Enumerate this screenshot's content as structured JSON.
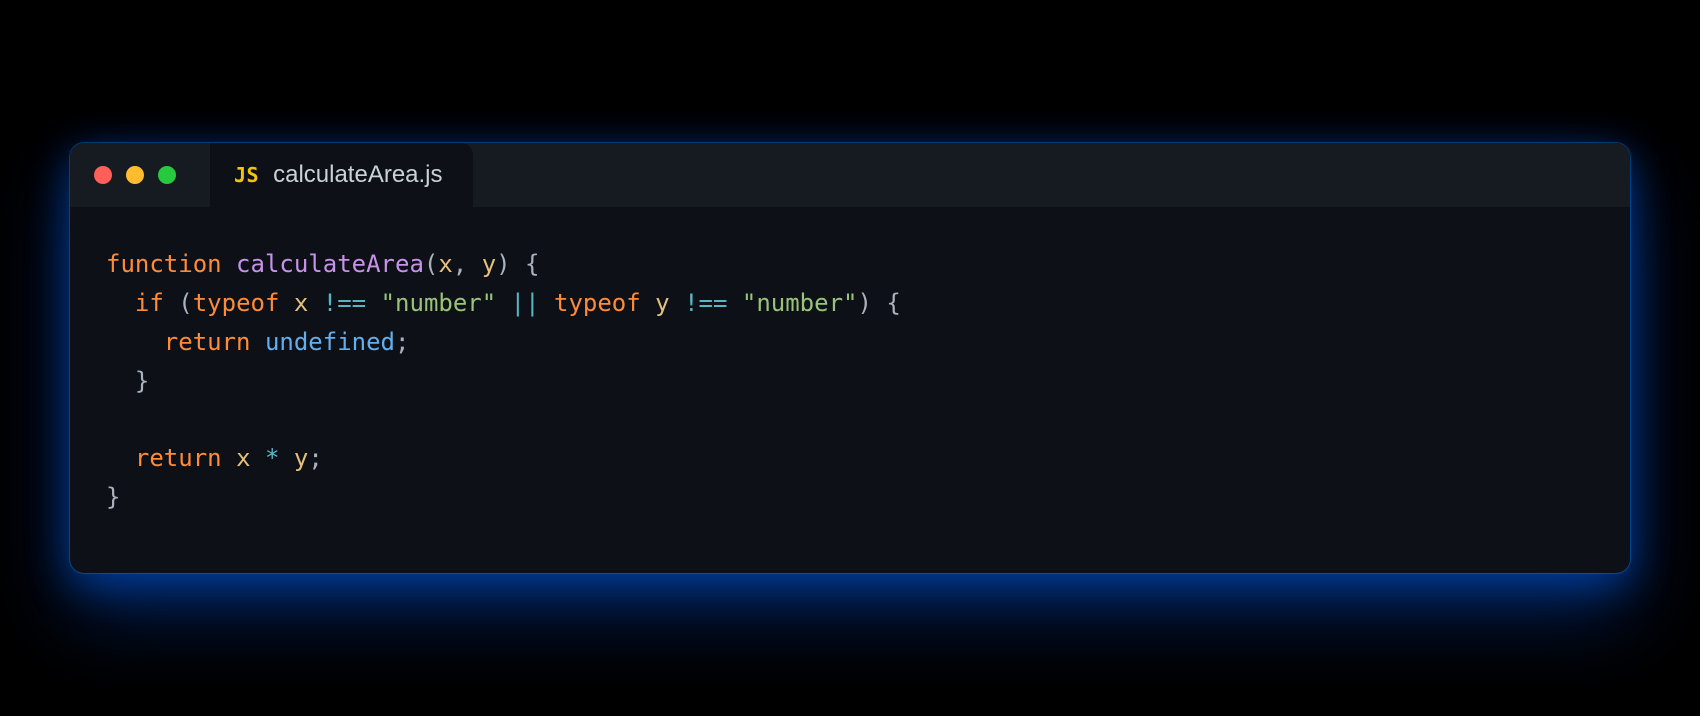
{
  "tab": {
    "icon_label": "JS",
    "filename": "calculateArea.js"
  },
  "code": {
    "lines": [
      [
        {
          "cls": "tok-keyword",
          "t": "function"
        },
        {
          "cls": "",
          "t": " "
        },
        {
          "cls": "tok-funcname",
          "t": "calculateArea"
        },
        {
          "cls": "tok-punct",
          "t": "("
        },
        {
          "cls": "tok-param",
          "t": "x"
        },
        {
          "cls": "tok-punct",
          "t": ", "
        },
        {
          "cls": "tok-param",
          "t": "y"
        },
        {
          "cls": "tok-punct",
          "t": ") {"
        }
      ],
      [
        {
          "cls": "",
          "t": "  "
        },
        {
          "cls": "tok-keyword",
          "t": "if"
        },
        {
          "cls": "tok-punct",
          "t": " ("
        },
        {
          "cls": "tok-keyword",
          "t": "typeof"
        },
        {
          "cls": "",
          "t": " "
        },
        {
          "cls": "tok-ident",
          "t": "x"
        },
        {
          "cls": "",
          "t": " "
        },
        {
          "cls": "tok-operator",
          "t": "!=="
        },
        {
          "cls": "",
          "t": " "
        },
        {
          "cls": "tok-string",
          "t": "\"number\""
        },
        {
          "cls": "",
          "t": " "
        },
        {
          "cls": "tok-operator",
          "t": "||"
        },
        {
          "cls": "",
          "t": " "
        },
        {
          "cls": "tok-keyword",
          "t": "typeof"
        },
        {
          "cls": "",
          "t": " "
        },
        {
          "cls": "tok-ident",
          "t": "y"
        },
        {
          "cls": "",
          "t": " "
        },
        {
          "cls": "tok-operator",
          "t": "!=="
        },
        {
          "cls": "",
          "t": " "
        },
        {
          "cls": "tok-string",
          "t": "\"number\""
        },
        {
          "cls": "tok-punct",
          "t": ") {"
        }
      ],
      [
        {
          "cls": "",
          "t": "    "
        },
        {
          "cls": "tok-keyword",
          "t": "return"
        },
        {
          "cls": "",
          "t": " "
        },
        {
          "cls": "tok-builtin",
          "t": "undefined"
        },
        {
          "cls": "tok-punct",
          "t": ";"
        }
      ],
      [
        {
          "cls": "",
          "t": "  "
        },
        {
          "cls": "tok-punct",
          "t": "}"
        }
      ],
      [
        {
          "cls": "",
          "t": ""
        }
      ],
      [
        {
          "cls": "",
          "t": "  "
        },
        {
          "cls": "tok-keyword",
          "t": "return"
        },
        {
          "cls": "",
          "t": " "
        },
        {
          "cls": "tok-ident",
          "t": "x"
        },
        {
          "cls": "",
          "t": " "
        },
        {
          "cls": "tok-operator",
          "t": "*"
        },
        {
          "cls": "",
          "t": " "
        },
        {
          "cls": "tok-ident",
          "t": "y"
        },
        {
          "cls": "tok-punct",
          "t": ";"
        }
      ],
      [
        {
          "cls": "tok-punct",
          "t": "}"
        }
      ]
    ]
  }
}
